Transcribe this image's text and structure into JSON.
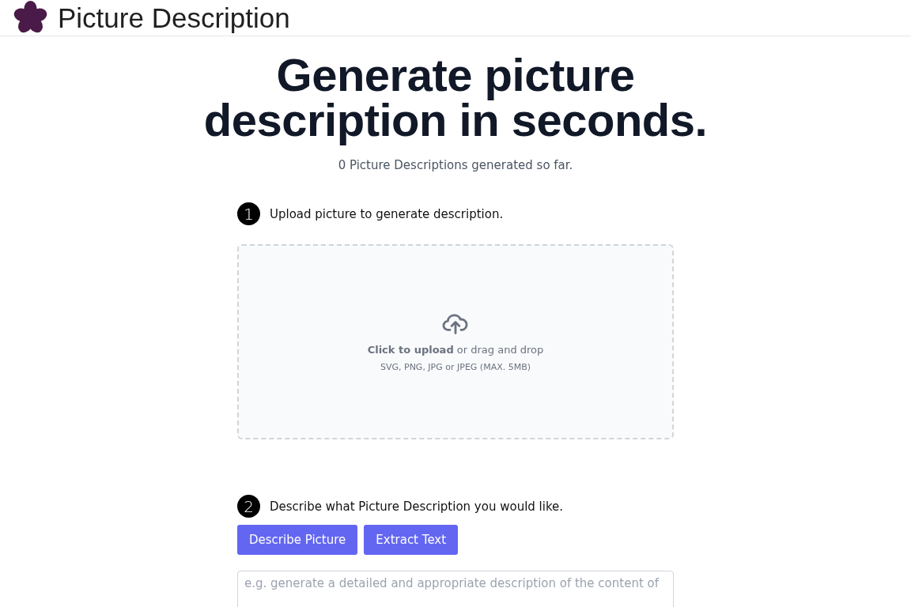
{
  "header": {
    "title": "Picture Description"
  },
  "hero": {
    "heading": "Generate picture description in seconds.",
    "counter": "0 Picture Descriptions generated so far."
  },
  "step_1": {
    "number": "1",
    "label": "Upload picture to generate description.",
    "upload": {
      "action": "Click to upload",
      "rest": " or drag and drop",
      "formats": "SVG, PNG, JPG or JPEG (MAX. 5MB)"
    }
  },
  "step_2": {
    "number": "2",
    "label": "Describe what Picture Description you would like.",
    "buttons": [
      "Describe Picture",
      "Extract Text"
    ],
    "prompt": {
      "placeholder": "e.g. generate a detailed and appropriate description of the content of"
    }
  }
}
